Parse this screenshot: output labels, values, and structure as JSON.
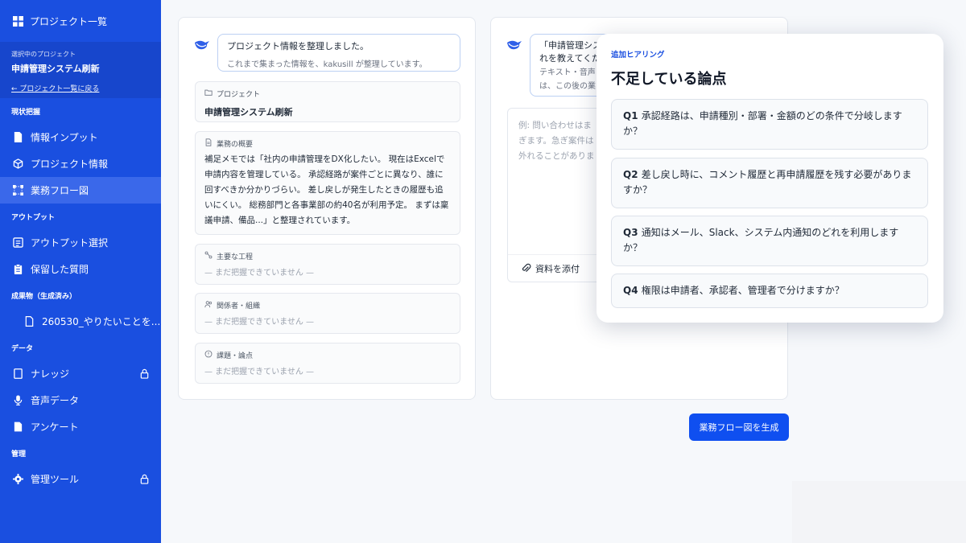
{
  "sidebar": {
    "top_label": "プロジェクト一覧",
    "project_caption": "選択中のプロジェクト",
    "project_name": "申請管理システム刷新",
    "back_link": "← プロジェクト一覧に戻る",
    "sections": {
      "current": "現状把握",
      "output": "アウトプット",
      "deliverables": "成果物（生成済み）",
      "data": "データ",
      "admin": "管理"
    },
    "items": {
      "info_input": "情報インプット",
      "project_info": "プロジェクト情報",
      "business_flow": "業務フロー図",
      "output_select": "アウトプット選択",
      "saved_questions": "保留した質問",
      "deliverable_1": "260530_やりたいことを...",
      "knowledge": "ナレッジ",
      "audio_data": "音声データ",
      "survey": "アンケート",
      "admin_tools": "管理ツール"
    }
  },
  "left_card": {
    "bubble_line1": "プロジェクト情報を整理しました。",
    "bubble_line2": "これまで集まった情報を、kakusill が整理しています。",
    "project_label": "プロジェクト",
    "project_value": "申請管理システム刷新",
    "overview_label": "業務の概要",
    "overview_text": "補足メモでは「社内の申請管理をDX化したい。 現在はExcelで申請内容を管理している。 承認経路が案件ごとに異なり、誰に回すべきか分かりづらい。 差し戻しが発生したときの履歴も追いにくい。 総務部門と各事業部の約40名が利用予定。 まずは稟議申請、備品...」と整理されています。",
    "process_label": "主要な工程",
    "stakeholder_label": "関係者・組織",
    "issue_label": "課題・論点",
    "empty_text": "— まだ把握できていません —"
  },
  "mid_card": {
    "bubble_line1": "「申請管理シス",
    "bubble_line1b": "れを教えてくださ",
    "bubble_line2": "テキスト・音声",
    "bubble_line2b": "は、この後の業",
    "placeholder_1": "例: 問い合わせはま",
    "placeholder_2": "ぎます。急ぎ案件は",
    "placeholder_3": "外れることがありま",
    "attach_label": "資料を添付"
  },
  "generate_button": "業務フロー図を生成",
  "popup": {
    "tag": "追加ヒアリング",
    "title": "不足している論点",
    "questions": [
      {
        "id": "Q1",
        "text": "承認経路は、申請種別・部署・金額のどの条件で分岐しますか？"
      },
      {
        "id": "Q2",
        "text": "差し戻し時に、コメント履歴と再申請履歴を残す必要がありますか？"
      },
      {
        "id": "Q3",
        "text": "通知はメール、Slack、システム内通知のどれを利用しますか？"
      },
      {
        "id": "Q4",
        "text": "権限は申請者、承認者、管理者で分けますか？"
      }
    ]
  },
  "colors": {
    "sidebar": "#1a4fe0",
    "sidebar_active": "#3a68ea",
    "accent": "#0f4ff0"
  }
}
